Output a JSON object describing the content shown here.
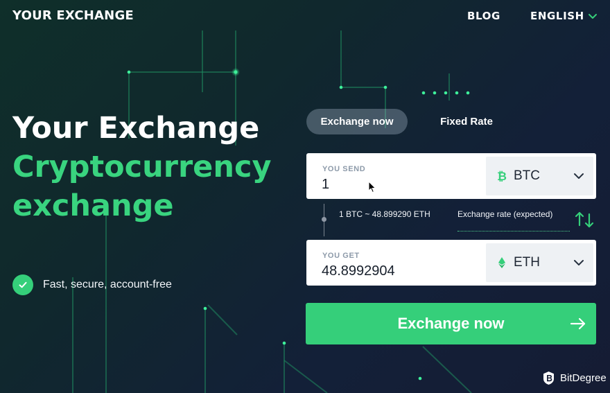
{
  "header": {
    "brand": "YOUR EXCHANGE",
    "nav": {
      "blog": "BLOG",
      "language": "ENGLISH"
    }
  },
  "hero": {
    "line1": "Your Exchange",
    "line2": "Cryptocurrency",
    "line3": "exchange",
    "feature": "Fast, secure, account-free"
  },
  "exchange": {
    "tabs": [
      {
        "label": "Exchange now",
        "active": true
      },
      {
        "label": "Fixed Rate",
        "active": false
      }
    ],
    "send": {
      "label": "YOU SEND",
      "amount": "1",
      "currency": {
        "code": "BTC",
        "icon": "bitcoin-icon"
      }
    },
    "rate": {
      "value": "1 BTC ~ 48.899290 ETH",
      "label": "Exchange rate (expected)"
    },
    "get": {
      "label": "YOU GET",
      "amount": "48.8992904",
      "currency": {
        "code": "ETH",
        "icon": "ethereum-icon"
      }
    },
    "cta": "Exchange now"
  },
  "watermark": {
    "text": "BitDegree",
    "icon": "bitdegree-shield-icon"
  },
  "colors": {
    "accent": "#35cf7a",
    "hero_green": "#39d47f",
    "card_bg": "#ffffff",
    "select_bg": "#eef1f4",
    "tab_active_bg": "rgba(168,186,203,0.35)"
  },
  "icons": {
    "language_chevron": "chevron-down-icon",
    "feature": "check-circle-icon",
    "swap": "swap-arrows-icon",
    "cta_arrow": "arrow-right-icon"
  }
}
